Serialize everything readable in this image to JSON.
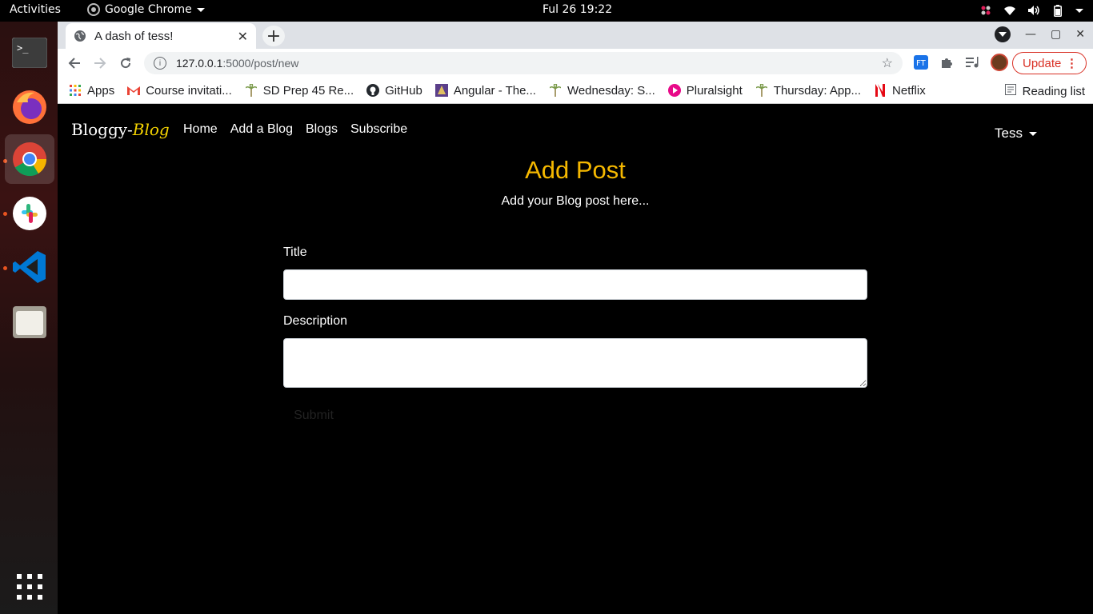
{
  "system_bar": {
    "activities": "Activities",
    "app_name": "Google Chrome",
    "clock": "Ful 26  19:22"
  },
  "dock": {
    "items": [
      "terminal-icon",
      "firefox-icon",
      "chrome-icon",
      "slack-icon",
      "vscode-icon",
      "files-icon",
      "app-grid-icon"
    ]
  },
  "browser": {
    "tab_title": "A dash of tess!",
    "url_host": "127.0.0.1",
    "url_path": ":5000/post/new",
    "update_label": "Update",
    "bookmarks": [
      "Apps",
      "Course invitati...",
      "SD Prep 45 Re...",
      "GitHub",
      "Angular - The...",
      "Wednesday: S...",
      "Pluralsight",
      "Thursday: App...",
      "Netflix"
    ],
    "reading_list": "Reading list"
  },
  "site": {
    "brand_plain": "Bloggy-",
    "brand_accent": "Blog",
    "nav": [
      "Home",
      "Add a Blog",
      "Blogs",
      "Subscribe"
    ],
    "user": "Tess"
  },
  "form": {
    "heading": "Add Post",
    "subheading": "Add your Blog post here...",
    "title_label": "Title",
    "title_value": "",
    "description_label": "Description",
    "description_value": "",
    "submit_label": "Submit"
  },
  "colors": {
    "heading": "#f5b800",
    "brand_accent": "#f5d400",
    "update": "#d93025"
  }
}
